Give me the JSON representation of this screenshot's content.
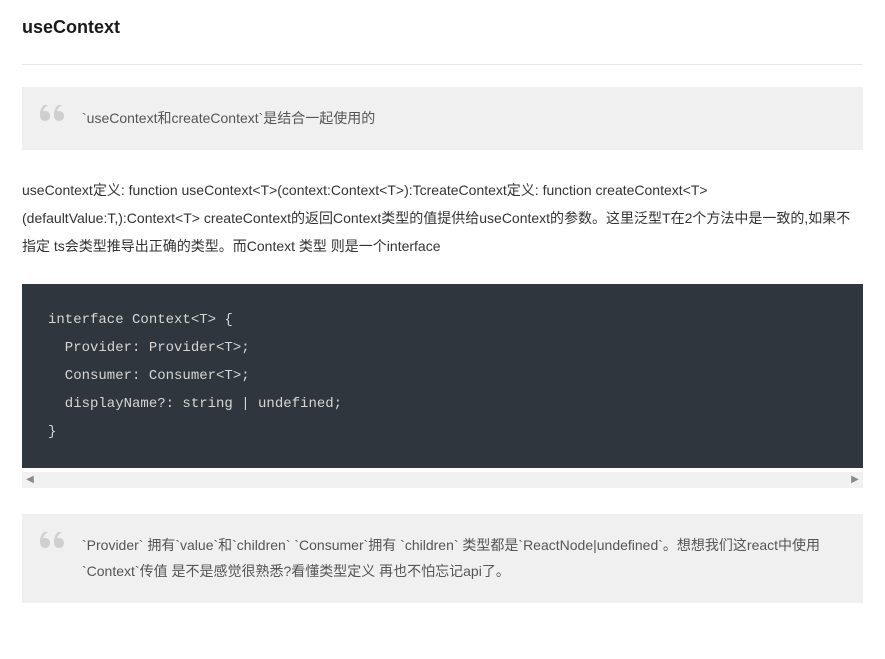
{
  "heading": "useContext",
  "quote1": "`useContext和createContext`是结合一起使用的",
  "paragraph": "useContext定义: function useContext<T>(context:Context<T>):TcreateContext定义: function createContext<T>(defaultValue:T,):Context<T> createContext的返回Context类型的值提供给useContext的参数。这里泛型T在2个方法中是一致的,如果不指定 ts会类型推导出正确的类型。而Context 类型 则是一个interface",
  "code": "interface Context<T> {\n  Provider: Provider<T>;\n  Consumer: Consumer<T>;\n  displayName?: string | undefined;\n}",
  "quote2": "`Provider` 拥有`value`和`children` `Consumer`拥有 `children` 类型都是`ReactNode|undefined`。想想我们这react中使用`Context`传值 是不是感觉很熟悉?看懂类型定义 再也不怕忘记api了。",
  "scrollbar": {
    "left_arrow": "◀",
    "right_arrow": "▶"
  }
}
